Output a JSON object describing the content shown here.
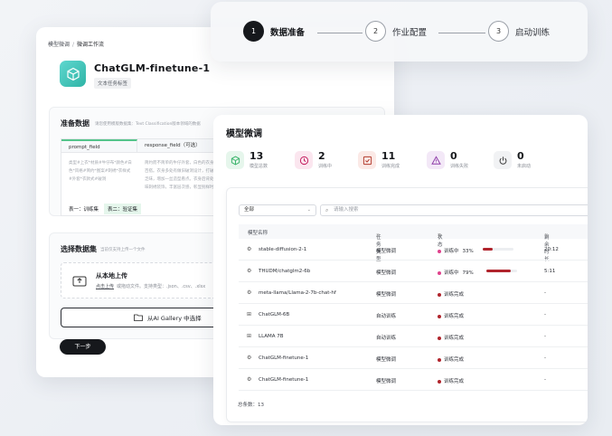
{
  "colors": {
    "accent_green": "#54c48a",
    "running": "#e0418c",
    "done": "#b0242c",
    "dark": "#16181c"
  },
  "breadcrumb": {
    "parent": "模型微调",
    "current": "微调工作流"
  },
  "app": {
    "title": "ChatGLM-finetune-1",
    "tag": "文本任务标签",
    "icon": "cube-icon"
  },
  "prep": {
    "title": "准备数据",
    "desc": "请您使用模版数据集：Text Classification版本领域的数据",
    "col_left": "prompt_field",
    "col_right": "response_field（可选）",
    "cell_left": "类型#上衣*材质#牛仔布*颜色#白色*风格#简约*图案#刺绣*衣样式#外套*衣款式#破洞",
    "cell_right": "简约而不简单的牛仔外套，白色的衣身十分百搭。衣身多处有做旧破洞设计，打破单调乏味，增加一丝造型看点。衣身后背处有趣味刺绣装饰，丰富层次感，彰显别样时尚。",
    "tabs": [
      "表一：训练集",
      "表二：验证集"
    ]
  },
  "select": {
    "title": "选择数据集",
    "desc": "当前仅支持上传一个文件",
    "upload_title": "从本地上传",
    "upload_link": "点击上传",
    "upload_desc": "或拖动文件。支持类型：.json、.csv、.xlsx",
    "gallery_label": "从AI Gallery 中选择"
  },
  "next_label": "下一步",
  "steps": [
    {
      "num": "1",
      "label": "数据准备"
    },
    {
      "num": "2",
      "label": "作业配置"
    },
    {
      "num": "3",
      "label": "启动训练"
    }
  ],
  "panel": {
    "title": "模型微调",
    "stats": [
      {
        "value": "13",
        "label": "模型总数",
        "icon": "cube-icon"
      },
      {
        "value": "2",
        "label": "训练中",
        "icon": "clock-icon"
      },
      {
        "value": "11",
        "label": "训练完成",
        "icon": "check-icon"
      },
      {
        "value": "0",
        "label": "训练失败",
        "icon": "warning-icon"
      },
      {
        "value": "0",
        "label": "未启动",
        "icon": "power-icon"
      }
    ],
    "filter_value": "全部",
    "search_placeholder": "请输入搜索",
    "headers": [
      "模型名称",
      "任务类型",
      "状态",
      "剩余时长"
    ],
    "rows": [
      {
        "name": "stable-diffusion-2-1",
        "type": "模型微调",
        "status": "训练中",
        "progress": "33%",
        "progress_value": 0.33,
        "time": "20:12",
        "icon": "spinner-icon"
      },
      {
        "name": "THUDM/chatglm2-6b",
        "type": "模型微调",
        "status": "训练中",
        "progress": "79%",
        "progress_value": 0.79,
        "time": "5:11",
        "icon": "spinner-icon"
      },
      {
        "name": "meta-llama/Llama-2-7b-chat-hf",
        "type": "模型微调",
        "status": "训练完成",
        "progress": "",
        "time": "-",
        "icon": "spinner-icon"
      },
      {
        "name": "ChatGLM-6B",
        "type": "自动训练",
        "status": "训练完成",
        "progress": "",
        "time": "-",
        "icon": "grid-icon"
      },
      {
        "name": "LLAMA 7B",
        "type": "自动训练",
        "status": "训练完成",
        "progress": "",
        "time": "-",
        "icon": "grid-icon"
      },
      {
        "name": "ChatGLM-finetune-1",
        "type": "模型微调",
        "status": "训练完成",
        "progress": "",
        "time": "-",
        "icon": "spinner-icon"
      },
      {
        "name": "ChatGLM-finetune-1",
        "type": "模型微调",
        "status": "训练完成",
        "progress": "",
        "time": "-",
        "icon": "spinner-icon"
      }
    ],
    "total": "总条数：13"
  }
}
